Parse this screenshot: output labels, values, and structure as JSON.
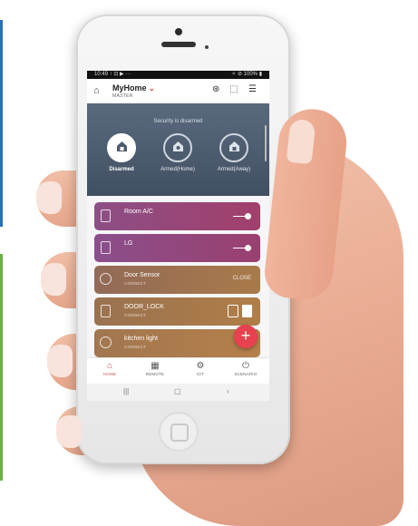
{
  "status_bar": {
    "time": "10:49",
    "left_icons": "↑ ⊡ ▶ ···",
    "right_icons": "✧ ⊘ 100%",
    "battery_glyph": "▮"
  },
  "header": {
    "title": "MyHome",
    "subtitle": "MASTER",
    "dropdown_glyph": "⌄",
    "home_glyph": "⌂",
    "icons": [
      "⊛",
      "⬚",
      "☰"
    ]
  },
  "security": {
    "status": "Security is disarmed",
    "modes": [
      {
        "label": "Disarmed",
        "active": true
      },
      {
        "label": "Armed(Home)",
        "active": false
      },
      {
        "label": "Armed(Away)",
        "active": false
      }
    ]
  },
  "devices": [
    {
      "name": "Room A/C",
      "status": "",
      "control": "toggle",
      "color": "#8e3a7a"
    },
    {
      "name": "LG",
      "status": "",
      "control": "toggle",
      "color": "#8c3b78"
    },
    {
      "name": "Door Sensor",
      "status": "CONNECT",
      "state": "CLOSE",
      "control": "text",
      "color": "#9a6a4a"
    },
    {
      "name": "DOOR_LOCK",
      "status": "CONNECT",
      "control": "lock",
      "color": "#a07248"
    },
    {
      "name": "kitchen light",
      "status": "CONNECT",
      "control": "none",
      "color": "#a87447"
    }
  ],
  "fab": {
    "glyph": "+"
  },
  "bottom_nav": [
    {
      "label": "HOME",
      "glyph": "⌂",
      "active": true
    },
    {
      "label": "REMOTE",
      "glyph": "▦",
      "active": false
    },
    {
      "label": "IOT",
      "glyph": "⚙",
      "active": false
    },
    {
      "label": "SCENARIO",
      "glyph": "⏻",
      "active": false
    }
  ],
  "system_nav": [
    "|||",
    "▢",
    "‹"
  ],
  "colors": {
    "accent": "#e8414f",
    "security_bg": "#4d5b6f"
  }
}
